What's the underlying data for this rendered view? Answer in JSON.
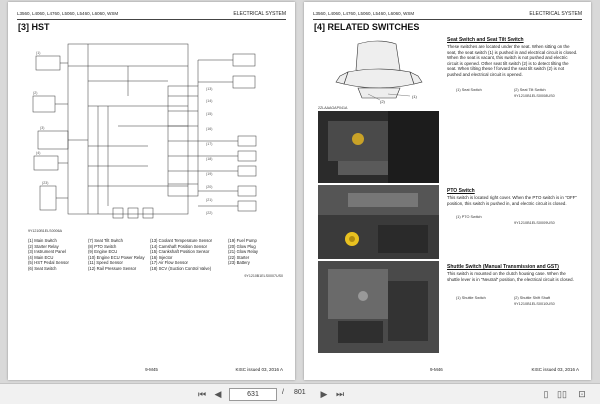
{
  "left_page": {
    "header_models": "L3560, L4060, L4760, L5060, L5460, L6060, WSM",
    "header_section": "ELECTRICAL SYSTEM",
    "section_title": "[3]  HST",
    "diagram_code": "9Y1210B1ELS0006A",
    "diagram_ref": "9Y1210B1ELS0007US0",
    "legend": [
      [
        "(1) Main Switch",
        "(7) Seat Tilt Switch",
        "(13) Coolant Temperature Sensor",
        "(19) Fuel Pump"
      ],
      [
        "(2) Starter Relay",
        "(8) PTO Switch",
        "(14) Camshaft Position Sensor",
        "(20) Glow Plug"
      ],
      [
        "(3) Instrument Panel",
        "(9) Engine ECU",
        "(15) Crankshaft Position Sensor",
        "(21) Glow Relay"
      ],
      [
        "(4) Main ECU",
        "(10) Engine ECU Power Relay",
        "(16) Injector",
        "(22) Starter"
      ],
      [
        "(5) HST Pedal Sensor",
        "(11) Speed Sensor",
        "(17) Air Flow Sensor",
        "(23) Battery"
      ],
      [
        "(6) Seat Switch",
        "(12) Rail Pressure Sensor",
        "(18) SCV (Suction Control Valve)",
        ""
      ]
    ],
    "page_number": "9-M45",
    "footer": "KISC issued 03, 2016 A"
  },
  "right_page": {
    "header_models": "L3560, L4060, L4760, L5060, L5460, L6060, WSM",
    "header_section": "ELECTRICAL SYSTEM",
    "section_title": "[4]  RELATED SWITCHES",
    "seat": {
      "title": "Seat Switch and Seat Tilt Switch",
      "text": "These switches are located under the seat. When sitting on the seat, the seat switch (1) is pushed in and electrical circuit is closed. When the seat is vacant, this switch is not pushed and electric circuit is opened. Other seat tilt switch (2) is to detect tilting the seat. When tilting these f forvard the seat tilt switch (2) is not pushed and electrical circuit is opened.",
      "cap1": "(1) Seat Switch",
      "cap2": "(2) Seat Tilt Switch",
      "img_code": "2ZLAAAGAP041A",
      "ref": "9Y1210B1ELS0008US0"
    },
    "pto": {
      "title": "PTO Switch",
      "text": "This switch is located right cover. When the PTO switch is in \"OFF\" position, this switch is pushed in, and electric circuit is closed.",
      "cap1": "(1) PTO Switch",
      "ref": "9Y1210B1ELS0009US0"
    },
    "shuttle": {
      "title": "Shuttle Switch (Manual Transmission and GST)",
      "text": "This switch is mounted on the clutch housing case. When the shuttle lever is in \"Neutral\" position, the electrical circuit is closed.",
      "cap1": "(1) Shuttle Switch",
      "cap2": "(2) Shuttle Shift Shaft",
      "ref": "9Y1210B1ELS0010US0"
    },
    "page_number": "9-M46",
    "footer": "KISC issued 03, 2016 A"
  },
  "toolbar": {
    "current_page": "631",
    "total_pages": "801",
    "separator": "/"
  }
}
